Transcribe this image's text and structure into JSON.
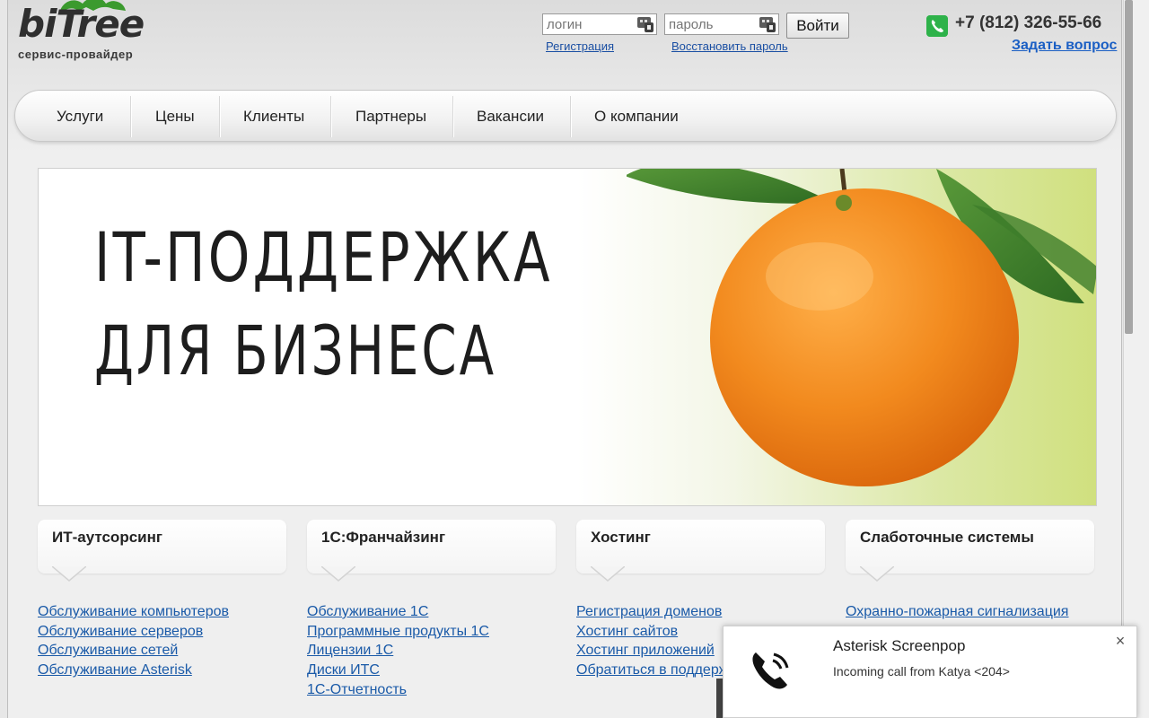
{
  "logo": {
    "name": "biTree",
    "tagline": "сервис-провайдер"
  },
  "login": {
    "login_placeholder": "логин",
    "password_placeholder": "пароль",
    "submit_label": "Войти",
    "register_link": "Регистрация",
    "restore_link": "Восстановить пароль"
  },
  "contact": {
    "phone": "+7 (812) 326-55-66",
    "ask_link": "Задать вопрос"
  },
  "nav": {
    "items": [
      "Услуги",
      "Цены",
      "Клиенты",
      "Партнеры",
      "Вакансии",
      "О компании"
    ]
  },
  "banner": {
    "line1": "IT-ПОДДЕРЖКА",
    "line2": "ДЛЯ БИЗНЕСА"
  },
  "categories": [
    {
      "title": "ИТ-аутсорсинг",
      "links": [
        "Обслуживание компьютеров",
        "Обслуживание серверов",
        "Обслуживание сетей",
        "Обслуживание Asterisk"
      ]
    },
    {
      "title": "1С:Франчайзинг",
      "links": [
        "Обслуживание 1С",
        "Программные продукты 1С",
        "Лицензии 1С",
        "Диски ИТС",
        "1С-Отчетность"
      ]
    },
    {
      "title": "Хостинг",
      "links": [
        "Регистрация доменов",
        "Хостинг сайтов",
        "Хостинг приложений",
        "Обратиться в поддерж"
      ]
    },
    {
      "title": "Слаботочные системы",
      "links": [
        "Охранно-пожарная сигнализация"
      ]
    }
  ],
  "notification": {
    "title": "Asterisk Screenpop",
    "message": "Incoming call from Katya <204>",
    "close_glyph": "×"
  },
  "colors": {
    "link": "#1a5aa8",
    "accent_green": "#2eb24a",
    "orange": "#f28a1e"
  }
}
